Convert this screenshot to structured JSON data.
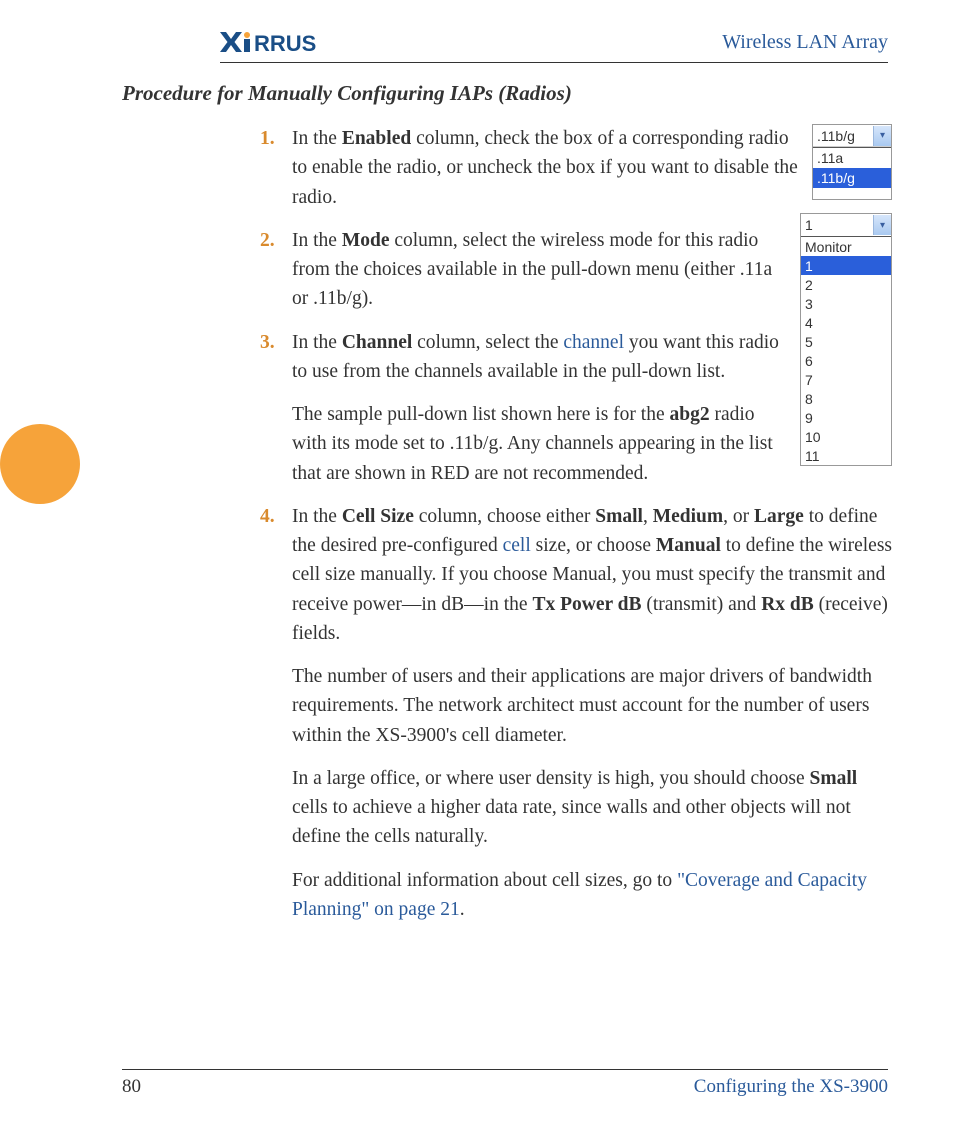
{
  "header": {
    "logo_text": "XIRRUS",
    "right_text": "Wireless LAN Array"
  },
  "section_title": "Procedure for Manually Configuring IAPs (Radios)",
  "steps": {
    "s1": {
      "p1_a": "In the ",
      "p1_b": "Enabled",
      "p1_c": " column, check the box of a corresponding radio to enable the radio, or uncheck the box if you want to disable the radio."
    },
    "s2": {
      "p1_a": "In the ",
      "p1_b": "Mode",
      "p1_c": " column, select the wireless mode for this radio from the choices available in the pull-down menu (either .11a or .11b/g)."
    },
    "s3": {
      "p1_a": "In the ",
      "p1_b": "Channel",
      "p1_c": " column, select the ",
      "p1_d": "channel",
      "p1_e": " you want this radio to use from the channels available in the pull-down list.",
      "p2_a": "The sample pull-down list shown here is for the ",
      "p2_b": "abg2",
      "p2_c": " radio with its mode set to .11b/g. Any channels appearing in the list that are shown in RED are not recommended."
    },
    "s4": {
      "p1_a": "In the ",
      "p1_b": "Cell Size",
      "p1_c": " column, choose either ",
      "p1_d": "Small",
      "p1_e": ", ",
      "p1_f": "Medium",
      "p1_g": ", or ",
      "p1_h": "Large",
      "p1_i": " to define the desired pre-configured ",
      "p1_j": "cell",
      "p1_k": " size, or choose ",
      "p1_l": "Manual",
      "p1_m": " to define the wireless cell size manually. If you choose Manual, you must specify the transmit and receive power—in dB—in the ",
      "p1_n": "Tx Power dB",
      "p1_o": " (transmit) and ",
      "p1_p": "Rx dB",
      "p1_q": " (receive) fields.",
      "p2": "The number of users and their applications are major drivers of bandwidth requirements. The network architect must account for the number of users within the XS-3900's cell diameter.",
      "p3_a": "In a large office, or where user density is high, you should choose ",
      "p3_b": "Small",
      "p3_c": " cells to achieve a higher data rate, since walls and other objects will not define the cells naturally.",
      "p4_a": "For additional information about cell sizes, go to ",
      "p4_b": "\"Coverage and Capacity Planning\" on page 21",
      "p4_c": "."
    }
  },
  "mode_dropdown": {
    "selected": ".11b/g",
    "options": [
      ".11a",
      ".11b/g"
    ],
    "highlight_index": 1
  },
  "channel_dropdown": {
    "selected": "1",
    "options": [
      "Monitor",
      "1",
      "2",
      "3",
      "4",
      "5",
      "6",
      "7",
      "8",
      "9",
      "10",
      "11"
    ],
    "highlight_index": 1
  },
  "footer": {
    "page_num": "80",
    "section": "Configuring the XS-3900"
  }
}
